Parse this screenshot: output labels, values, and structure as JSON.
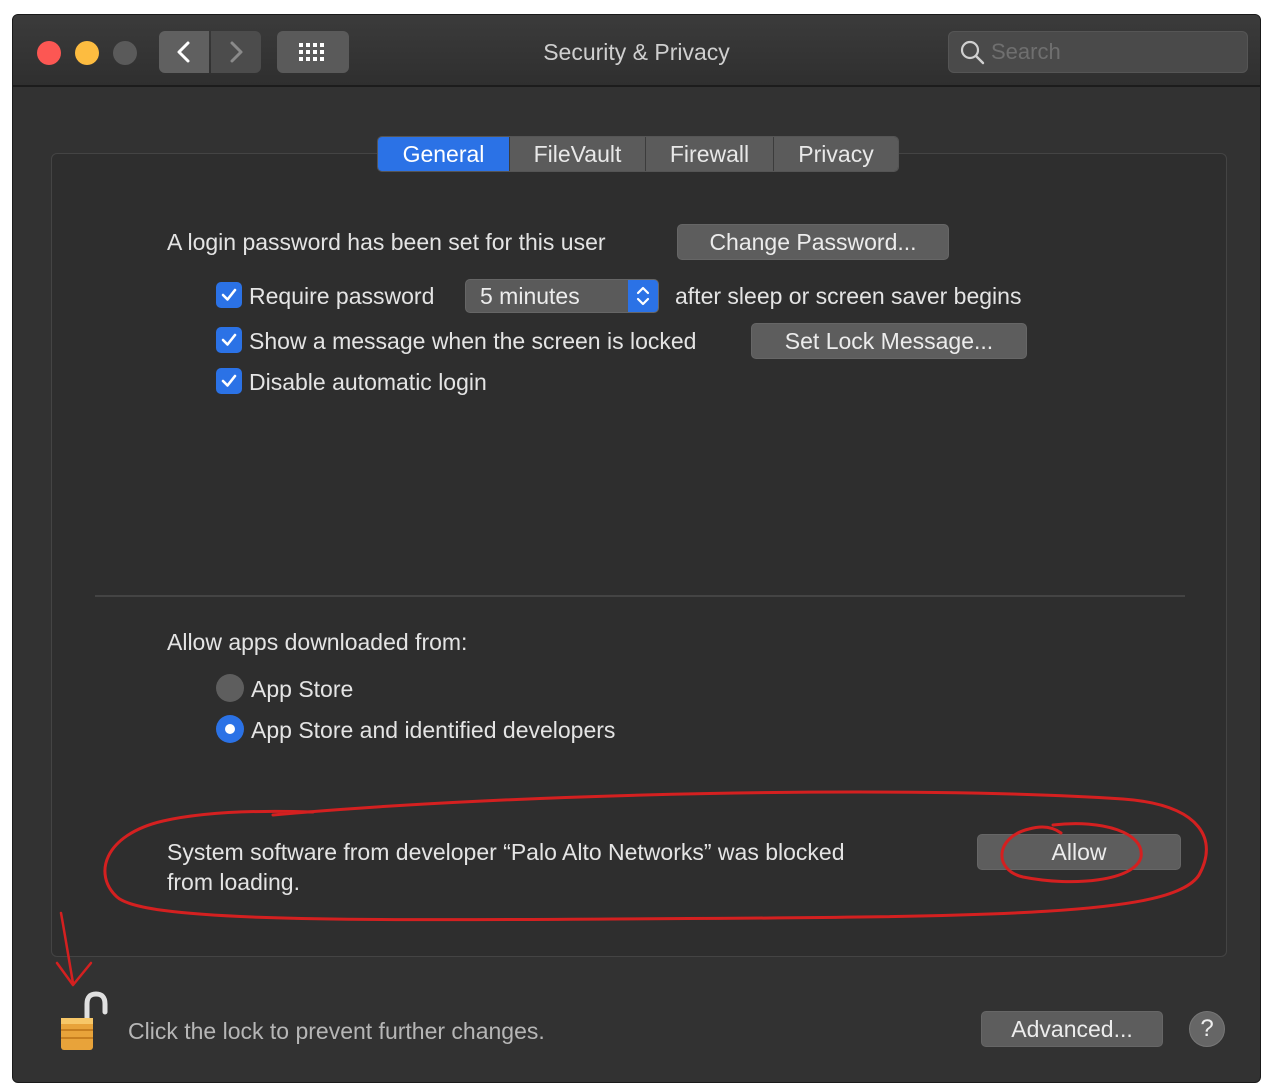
{
  "window": {
    "title": "Security & Privacy",
    "search_placeholder": "Search"
  },
  "tabs": [
    {
      "label": "General",
      "active": true
    },
    {
      "label": "FileVault",
      "active": false
    },
    {
      "label": "Firewall",
      "active": false
    },
    {
      "label": "Privacy",
      "active": false
    }
  ],
  "general": {
    "login_text": "A login password has been set for this user",
    "change_password_label": "Change Password...",
    "require_password": {
      "label": "Require password",
      "checked": true
    },
    "require_password_delay": "5 minutes",
    "after_sleep_text": "after sleep or screen saver begins",
    "show_message": {
      "label": "Show a message when the screen is locked",
      "checked": true
    },
    "set_lock_message_label": "Set Lock Message...",
    "disable_auto_login": {
      "label": "Disable automatic login",
      "checked": true
    },
    "allow_apps_heading": "Allow apps downloaded from:",
    "radio_options": [
      {
        "label": "App Store",
        "selected": false
      },
      {
        "label": "App Store and identified developers",
        "selected": true
      }
    ],
    "blocked_message_line1": "System software from developer “Palo Alto Networks” was blocked",
    "blocked_message_line2": "from loading.",
    "allow_button_label": "Allow"
  },
  "footer": {
    "lock_text": "Click the lock to prevent further changes.",
    "advanced_label": "Advanced...",
    "help_label": "?"
  },
  "colors": {
    "accent": "#2b72e6",
    "annotation": "#d42020",
    "window_bg": "#323232"
  }
}
